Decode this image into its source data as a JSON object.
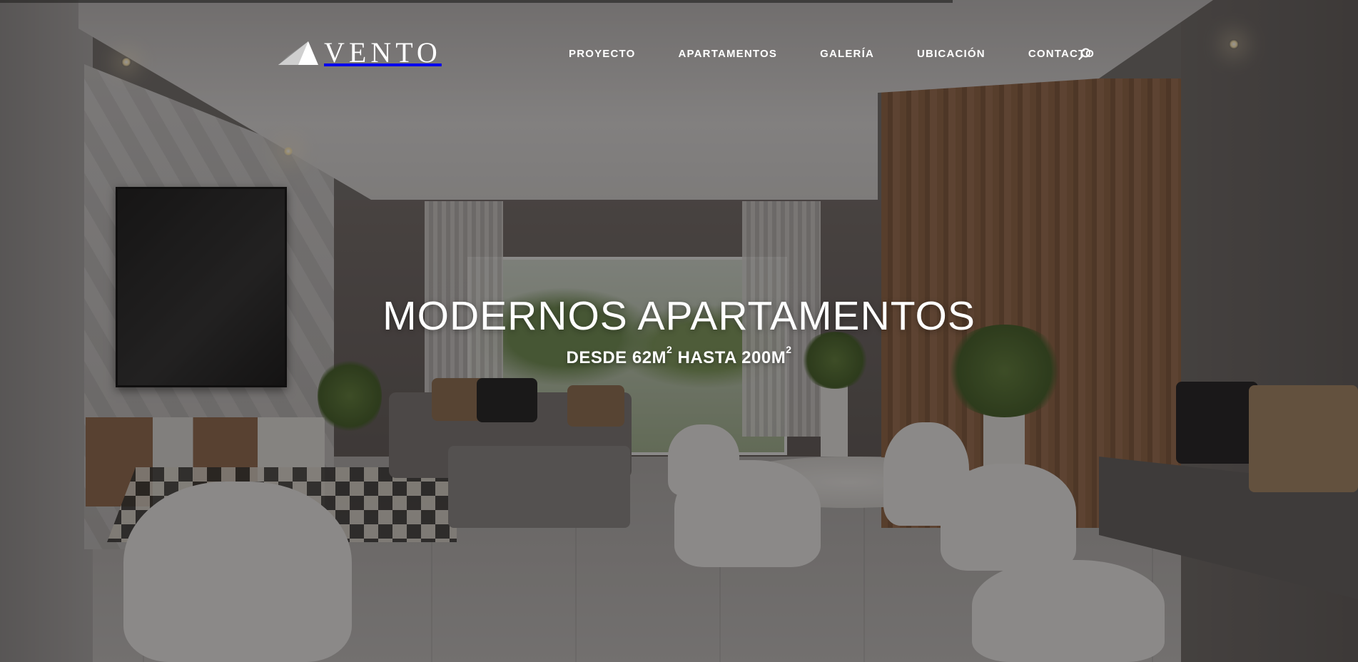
{
  "brand": {
    "name": "VENTO"
  },
  "nav": {
    "items": [
      {
        "label": "PROYECTO"
      },
      {
        "label": "APARTAMENTOS"
      },
      {
        "label": "GALERÍA"
      },
      {
        "label": "UBICACIÓN"
      },
      {
        "label": "CONTACTO"
      }
    ],
    "search_icon": "search-icon"
  },
  "hero": {
    "title": "MODERNOS APARTAMENTOS",
    "subtitle_prefix": "DESDE 62M",
    "subtitle_sup1": "2",
    "subtitle_middle": " HASTA 200M",
    "subtitle_sup2": "2"
  },
  "colors": {
    "text": "#ffffff",
    "overlay": "rgba(25,22,22,0.45)"
  }
}
